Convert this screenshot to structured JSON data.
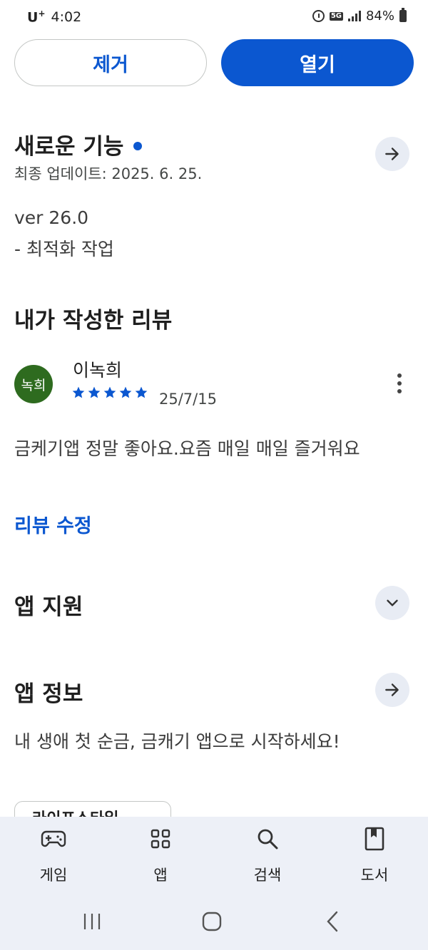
{
  "status_bar": {
    "carrier": "U",
    "carrier_sup": "+",
    "time": "4:02",
    "network": "5G",
    "battery": "84%"
  },
  "actions": {
    "remove_label": "제거",
    "open_label": "열기"
  },
  "whats_new": {
    "title": "새로운 기능",
    "last_updated": "최종 업데이트: 2025. 6. 25.",
    "version": "ver 26.0",
    "notes": "- 최적화 작업"
  },
  "my_review": {
    "title": "내가 작성한 리뷰",
    "avatar_text": "녹희",
    "reviewer": "이녹희",
    "rating": 5,
    "date": "25/7/15",
    "text": "금케기앱 정말 좋아요.요즘 매일 매일 즐거워요",
    "edit_label": "리뷰 수정"
  },
  "app_support": {
    "title": "앱 지원"
  },
  "app_info": {
    "title": "앱 정보",
    "description": "내 생애 첫 순금, 금캐기 앱으로 시작하세요!",
    "partial_chip": "라이프스타일"
  },
  "bottom_nav": {
    "items": [
      {
        "label": "게임",
        "icon": "gamepad-icon"
      },
      {
        "label": "앱",
        "icon": "apps-grid-icon"
      },
      {
        "label": "검색",
        "icon": "search-icon"
      },
      {
        "label": "도서",
        "icon": "book-icon"
      }
    ]
  },
  "colors": {
    "accent": "#0b57d0",
    "avatar": "#2e6b1f",
    "nav_bg": "#edf0f7"
  }
}
